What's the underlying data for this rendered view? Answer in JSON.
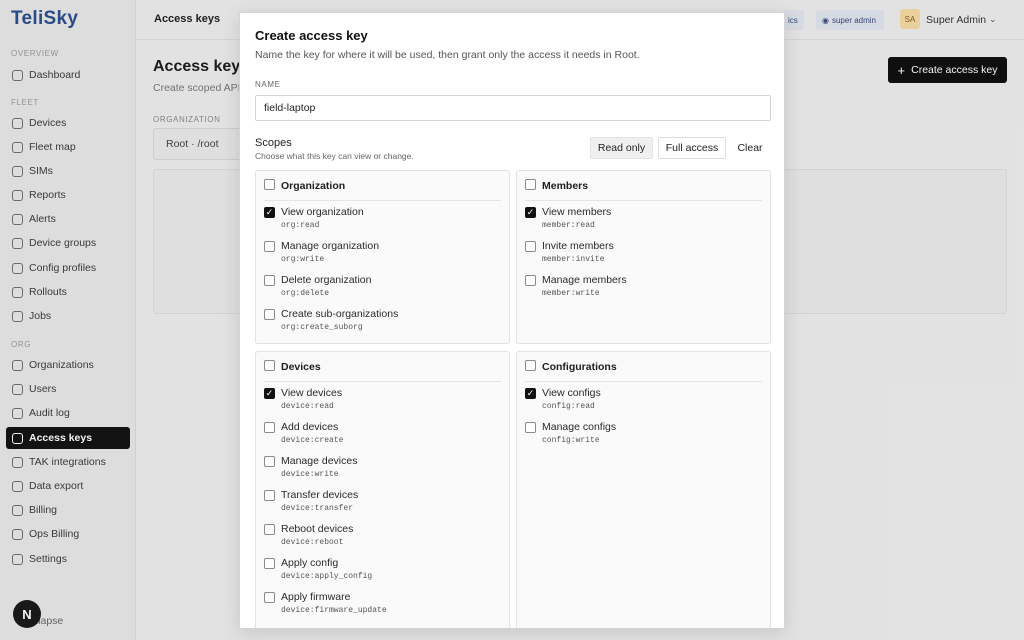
{
  "brand": "TeliSky",
  "sidebar": {
    "sections": [
      "OVERVIEW",
      "FLEET",
      "ORG"
    ],
    "items": [
      {
        "label": "Dashboard"
      },
      {
        "label": "Devices"
      },
      {
        "label": "Fleet map"
      },
      {
        "label": "SIMs"
      },
      {
        "label": "Reports"
      },
      {
        "label": "Alerts"
      },
      {
        "label": "Device groups"
      },
      {
        "label": "Config profiles"
      },
      {
        "label": "Rollouts"
      },
      {
        "label": "Jobs"
      },
      {
        "label": "Organizations"
      },
      {
        "label": "Users"
      },
      {
        "label": "Audit log"
      },
      {
        "label": "Access keys"
      },
      {
        "label": "TAK integrations"
      },
      {
        "label": "Data export"
      },
      {
        "label": "Billing"
      },
      {
        "label": "Ops Billing"
      },
      {
        "label": "Settings"
      }
    ],
    "collapse_label": "ollapse",
    "avatar_letter": "N"
  },
  "topbar": {
    "title": "Access keys",
    "pill_left": "ics",
    "role_badge": "super admin",
    "user_initials": "SA",
    "user_name": "Super Admin"
  },
  "page": {
    "title": "Access keys",
    "subtitle": "Create scoped API",
    "org_label": "ORGANIZATION",
    "org_value": "Root · /root",
    "create_button": "Create access key"
  },
  "modal": {
    "title": "Create access key",
    "description": "Name the key for where it will be used, then grant only the access it needs in Root.",
    "name_label": "NAME",
    "name_value": "field-laptop",
    "scopes_label": "Scopes",
    "scopes_help": "Choose what this key can view or change.",
    "buttons": {
      "read_only": "Read only",
      "full_access": "Full access",
      "clear": "Clear"
    },
    "groups": [
      {
        "title": "Organization",
        "checked": false,
        "scopes": [
          {
            "label": "View organization",
            "code": "org:read",
            "checked": true
          },
          {
            "label": "Manage organization",
            "code": "org:write",
            "checked": false
          },
          {
            "label": "Delete organization",
            "code": "org:delete",
            "checked": false
          },
          {
            "label": "Create sub-organizations",
            "code": "org:create_suborg",
            "checked": false
          }
        ]
      },
      {
        "title": "Members",
        "checked": false,
        "scopes": [
          {
            "label": "View members",
            "code": "member:read",
            "checked": true
          },
          {
            "label": "Invite members",
            "code": "member:invite",
            "checked": false
          },
          {
            "label": "Manage members",
            "code": "member:write",
            "checked": false
          }
        ]
      },
      {
        "title": "Devices",
        "checked": false,
        "scopes": [
          {
            "label": "View devices",
            "code": "device:read",
            "checked": true
          },
          {
            "label": "Add devices",
            "code": "device:create",
            "checked": false
          },
          {
            "label": "Manage devices",
            "code": "device:write",
            "checked": false
          },
          {
            "label": "Transfer devices",
            "code": "device:transfer",
            "checked": false
          },
          {
            "label": "Reboot devices",
            "code": "device:reboot",
            "checked": false
          },
          {
            "label": "Apply config",
            "code": "device:apply_config",
            "checked": false
          },
          {
            "label": "Apply firmware",
            "code": "device:firmware_update",
            "checked": false
          }
        ]
      },
      {
        "title": "Configurations",
        "checked": false,
        "scopes": [
          {
            "label": "View configs",
            "code": "config:read",
            "checked": true
          },
          {
            "label": "Manage configs",
            "code": "config:write",
            "checked": false
          }
        ]
      }
    ]
  }
}
